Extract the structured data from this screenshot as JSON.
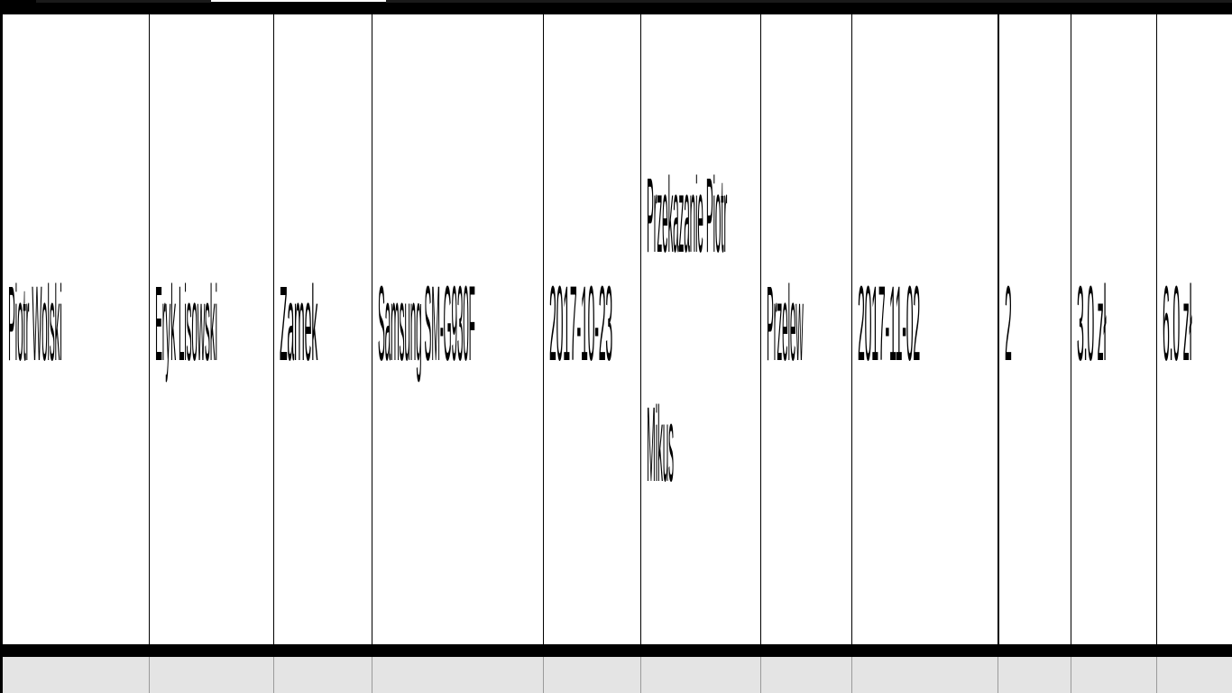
{
  "row": {
    "cells": [
      "Piotr Wolski",
      "Eryk Lisowski",
      "Zamek",
      "Samsung SM-G930F",
      "2017-10-23",
      "Przekazanie Piotr",
      "Przelew",
      "2017-11-02",
      "2",
      "3.0 zł",
      "6.0 zł"
    ],
    "cell_5_line2": "Mikus"
  },
  "colors": {
    "background": "#ffffff",
    "borders": "#000000",
    "footer": "#e4e4e4"
  }
}
